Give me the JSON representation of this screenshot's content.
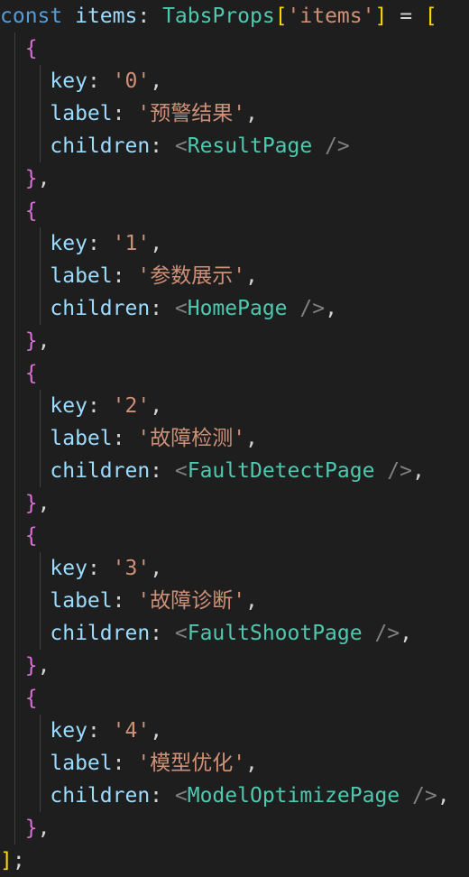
{
  "code": {
    "lines": [
      [
        {
          "t": "const",
          "c": "kw"
        },
        {
          "t": " ",
          "c": "punc"
        },
        {
          "t": "items",
          "c": "var"
        },
        {
          "t": ": ",
          "c": "punc"
        },
        {
          "t": "TabsProps",
          "c": "type"
        },
        {
          "t": "[",
          "c": "br1"
        },
        {
          "t": "'items'",
          "c": "str"
        },
        {
          "t": "]",
          "c": "br1"
        },
        {
          "t": " = ",
          "c": "punc"
        },
        {
          "t": "[",
          "c": "br1"
        }
      ],
      [
        {
          "t": "  ",
          "c": "punc"
        },
        {
          "t": "{",
          "c": "br2"
        }
      ],
      [
        {
          "t": "    ",
          "c": "punc"
        },
        {
          "t": "key",
          "c": "prop"
        },
        {
          "t": ": ",
          "c": "punc"
        },
        {
          "t": "'0'",
          "c": "str"
        },
        {
          "t": ",",
          "c": "punc"
        }
      ],
      [
        {
          "t": "    ",
          "c": "punc"
        },
        {
          "t": "label",
          "c": "prop"
        },
        {
          "t": ": ",
          "c": "punc"
        },
        {
          "t": "'预警结果'",
          "c": "str"
        },
        {
          "t": ",",
          "c": "punc"
        }
      ],
      [
        {
          "t": "    ",
          "c": "punc"
        },
        {
          "t": "children",
          "c": "prop"
        },
        {
          "t": ": ",
          "c": "punc"
        },
        {
          "t": "<",
          "c": "tag"
        },
        {
          "t": "ResultPage",
          "c": "comp"
        },
        {
          "t": " />",
          "c": "tag"
        }
      ],
      [
        {
          "t": "  ",
          "c": "punc"
        },
        {
          "t": "}",
          "c": "br2"
        },
        {
          "t": ",",
          "c": "punc"
        }
      ],
      [
        {
          "t": "  ",
          "c": "punc"
        },
        {
          "t": "{",
          "c": "br2"
        }
      ],
      [
        {
          "t": "    ",
          "c": "punc"
        },
        {
          "t": "key",
          "c": "prop"
        },
        {
          "t": ": ",
          "c": "punc"
        },
        {
          "t": "'1'",
          "c": "str"
        },
        {
          "t": ",",
          "c": "punc"
        }
      ],
      [
        {
          "t": "    ",
          "c": "punc"
        },
        {
          "t": "label",
          "c": "prop"
        },
        {
          "t": ": ",
          "c": "punc"
        },
        {
          "t": "'参数展示'",
          "c": "str"
        },
        {
          "t": ",",
          "c": "punc"
        }
      ],
      [
        {
          "t": "    ",
          "c": "punc"
        },
        {
          "t": "children",
          "c": "prop"
        },
        {
          "t": ": ",
          "c": "punc"
        },
        {
          "t": "<",
          "c": "tag"
        },
        {
          "t": "HomePage",
          "c": "comp"
        },
        {
          "t": " />",
          "c": "tag"
        },
        {
          "t": ",",
          "c": "punc"
        }
      ],
      [
        {
          "t": "  ",
          "c": "punc"
        },
        {
          "t": "}",
          "c": "br2"
        },
        {
          "t": ",",
          "c": "punc"
        }
      ],
      [
        {
          "t": "  ",
          "c": "punc"
        },
        {
          "t": "{",
          "c": "br2"
        }
      ],
      [
        {
          "t": "    ",
          "c": "punc"
        },
        {
          "t": "key",
          "c": "prop"
        },
        {
          "t": ": ",
          "c": "punc"
        },
        {
          "t": "'2'",
          "c": "str"
        },
        {
          "t": ",",
          "c": "punc"
        }
      ],
      [
        {
          "t": "    ",
          "c": "punc"
        },
        {
          "t": "label",
          "c": "prop"
        },
        {
          "t": ": ",
          "c": "punc"
        },
        {
          "t": "'故障检测'",
          "c": "str"
        },
        {
          "t": ",",
          "c": "punc"
        }
      ],
      [
        {
          "t": "    ",
          "c": "punc"
        },
        {
          "t": "children",
          "c": "prop"
        },
        {
          "t": ": ",
          "c": "punc"
        },
        {
          "t": "<",
          "c": "tag"
        },
        {
          "t": "FaultDetectPage",
          "c": "comp"
        },
        {
          "t": " />",
          "c": "tag"
        },
        {
          "t": ",",
          "c": "punc"
        }
      ],
      [
        {
          "t": "  ",
          "c": "punc"
        },
        {
          "t": "}",
          "c": "br2"
        },
        {
          "t": ",",
          "c": "punc"
        }
      ],
      [
        {
          "t": "  ",
          "c": "punc"
        },
        {
          "t": "{",
          "c": "br2"
        }
      ],
      [
        {
          "t": "    ",
          "c": "punc"
        },
        {
          "t": "key",
          "c": "prop"
        },
        {
          "t": ": ",
          "c": "punc"
        },
        {
          "t": "'3'",
          "c": "str"
        },
        {
          "t": ",",
          "c": "punc"
        }
      ],
      [
        {
          "t": "    ",
          "c": "punc"
        },
        {
          "t": "label",
          "c": "prop"
        },
        {
          "t": ": ",
          "c": "punc"
        },
        {
          "t": "'故障诊断'",
          "c": "str"
        },
        {
          "t": ",",
          "c": "punc"
        }
      ],
      [
        {
          "t": "    ",
          "c": "punc"
        },
        {
          "t": "children",
          "c": "prop"
        },
        {
          "t": ": ",
          "c": "punc"
        },
        {
          "t": "<",
          "c": "tag"
        },
        {
          "t": "FaultShootPage",
          "c": "comp"
        },
        {
          "t": " />",
          "c": "tag"
        },
        {
          "t": ",",
          "c": "punc"
        }
      ],
      [
        {
          "t": "  ",
          "c": "punc"
        },
        {
          "t": "}",
          "c": "br2"
        },
        {
          "t": ",",
          "c": "punc"
        }
      ],
      [
        {
          "t": "  ",
          "c": "punc"
        },
        {
          "t": "{",
          "c": "br2"
        }
      ],
      [
        {
          "t": "    ",
          "c": "punc"
        },
        {
          "t": "key",
          "c": "prop"
        },
        {
          "t": ": ",
          "c": "punc"
        },
        {
          "t": "'4'",
          "c": "str"
        },
        {
          "t": ",",
          "c": "punc"
        }
      ],
      [
        {
          "t": "    ",
          "c": "punc"
        },
        {
          "t": "label",
          "c": "prop"
        },
        {
          "t": ": ",
          "c": "punc"
        },
        {
          "t": "'模型优化'",
          "c": "str"
        },
        {
          "t": ",",
          "c": "punc"
        }
      ],
      [
        {
          "t": "    ",
          "c": "punc"
        },
        {
          "t": "children",
          "c": "prop"
        },
        {
          "t": ": ",
          "c": "punc"
        },
        {
          "t": "<",
          "c": "tag"
        },
        {
          "t": "ModelOptimizePage",
          "c": "comp"
        },
        {
          "t": " />",
          "c": "tag"
        },
        {
          "t": ",",
          "c": "punc"
        }
      ],
      [
        {
          "t": "  ",
          "c": "punc"
        },
        {
          "t": "}",
          "c": "br2"
        },
        {
          "t": ",",
          "c": "punc"
        }
      ],
      [
        {
          "t": "]",
          "c": "br1"
        },
        {
          "t": ";",
          "c": "punc"
        }
      ]
    ]
  },
  "theme": {
    "background": "#1e1e1e",
    "keyword": "#569cd6",
    "variable": "#9cdcfe",
    "type": "#4ec9b0",
    "string": "#ce9178",
    "bracket_level1": "#ffd700",
    "bracket_level2": "#da70d6",
    "punctuation": "#d4d4d4",
    "jsx_tag": "#808080"
  }
}
